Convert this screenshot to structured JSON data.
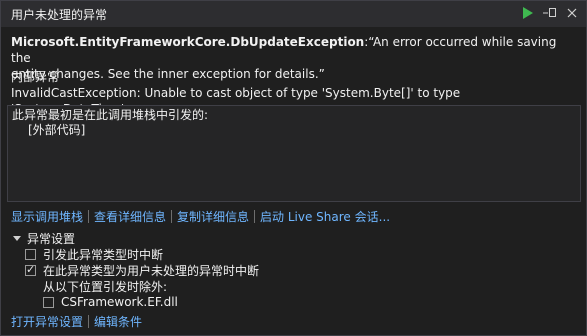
{
  "window": {
    "title": "用户未处理的异常"
  },
  "exception": {
    "type": "Microsoft.EntityFrameworkCore.DbUpdateException",
    "message_line1": ":“An error occurred while saving the",
    "message_line2": "entity changes. See the inner exception for details.”"
  },
  "inner": {
    "heading": "内部异常",
    "message": "InvalidCastException: Unable to cast object of type 'System.Byte[]' to type 'System.DateTime'."
  },
  "stack": {
    "intro": "此异常最初是在此调用堆栈中引发的:",
    "frame": "[外部代码]"
  },
  "links": {
    "show_call_stack": "显示调用堆栈",
    "view_details": "查看详细信息",
    "copy_details": "复制详细信息",
    "start_live_share": "启动 Live Share 会话..."
  },
  "settings": {
    "header": "异常设置",
    "opt_break_thrown": "引发此异常类型时中断",
    "opt_break_unhandled": "在此异常类型为用户未处理的异常时中断",
    "except_label": "从以下位置引发时除外:",
    "except_module": "CSFramework.EF.dll",
    "checked_thrown": false,
    "checked_unhandled": true,
    "checked_module": false
  },
  "bottom_links": {
    "open_settings": "打开异常设置",
    "edit_conditions": "编辑条件"
  },
  "colors": {
    "link": "#6fb6ff",
    "play": "#3fb950",
    "background": "#1f1f1f"
  }
}
